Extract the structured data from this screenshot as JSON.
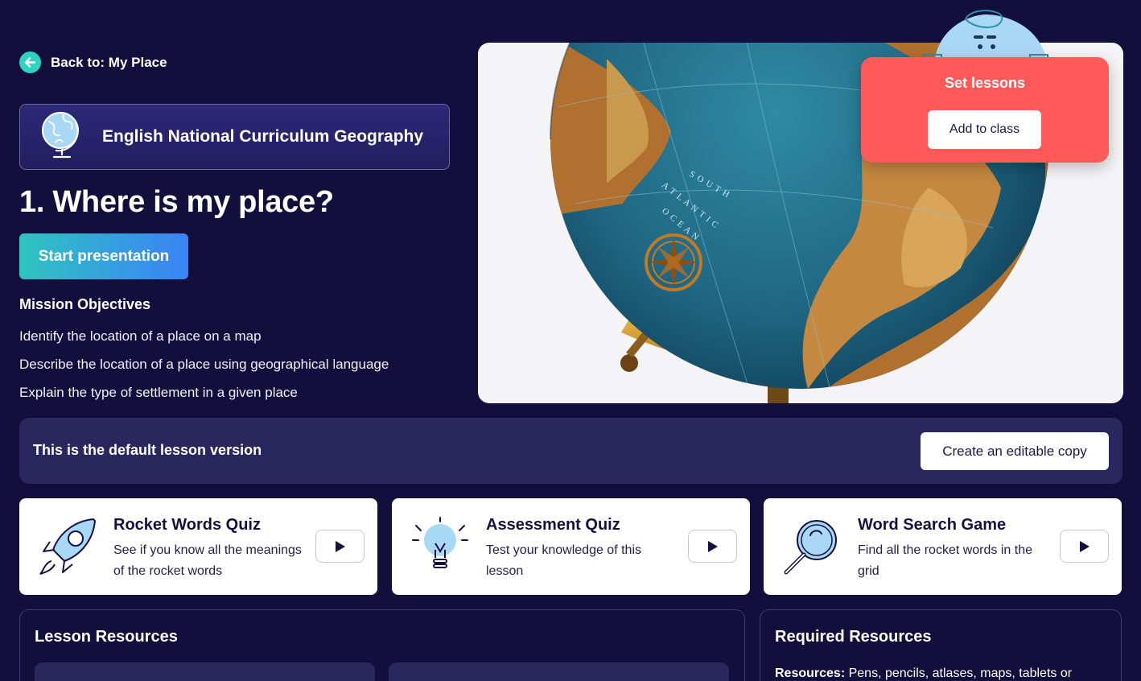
{
  "back": {
    "label": "Back to: My Place",
    "icon": "arrow-left-icon"
  },
  "curriculum": {
    "title": "English National Curriculum Geography",
    "icon": "globe-icon"
  },
  "lesson": {
    "title": "1. Where is my place?",
    "start_label": "Start presentation",
    "objectives_heading": "Mission Objectives",
    "objectives": [
      "Identify the location of a place on a map",
      "Describe the location of a place using geographical language",
      "Explain the type of settlement in a given place"
    ]
  },
  "hero": {
    "ocean_label": [
      "S",
      "O",
      "U",
      "T",
      "H",
      "A",
      "T",
      "L",
      "A",
      "N",
      "T",
      "I",
      "C",
      "O",
      "C",
      "E",
      "A",
      "N"
    ]
  },
  "set_lessons": {
    "title": "Set lessons",
    "add_label": "Add to class"
  },
  "version": {
    "text": "This is the default lesson version",
    "copy_label": "Create an editable copy"
  },
  "activities": [
    {
      "title": "Rocket Words Quiz",
      "desc": "See if you know all the meanings of the rocket words",
      "icon": "rocket-icon"
    },
    {
      "title": "Assessment Quiz",
      "desc": "Test your knowledge of this lesson",
      "icon": "lightbulb-icon"
    },
    {
      "title": "Word Search Game",
      "desc": "Find all the rocket words in the grid",
      "icon": "magnifier-icon"
    }
  ],
  "resources": {
    "lesson_heading": "Lesson Resources",
    "required_heading": "Required Resources",
    "required_label": "Resources:",
    "required_text": " Pens, pencils, atlases, maps, tablets or"
  },
  "colors": {
    "background": "#120f3d",
    "accent_teal": "#2dd4bf",
    "accent_blue": "#3b82f6",
    "set_card": "#ff5a5a",
    "panel": "#2a265e"
  }
}
